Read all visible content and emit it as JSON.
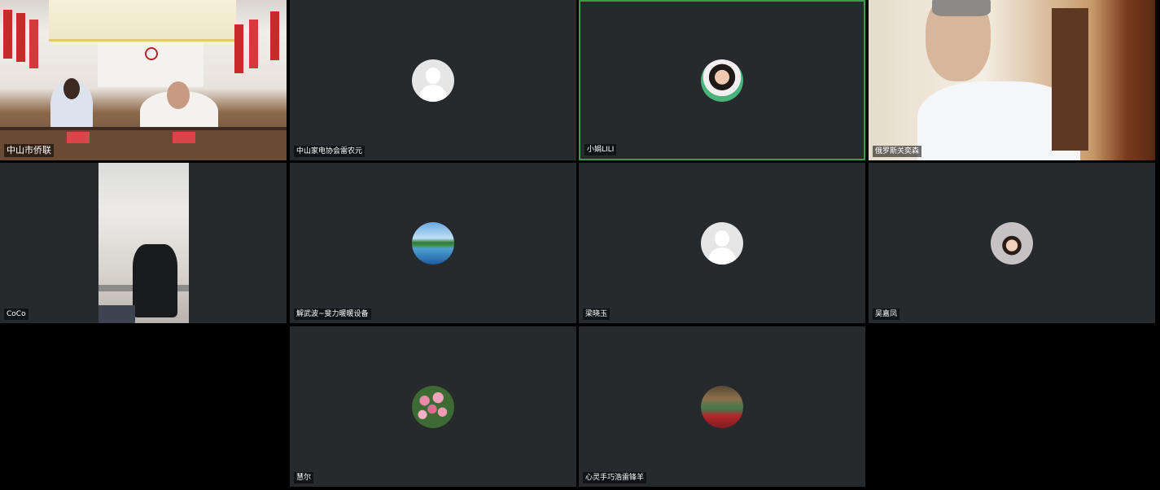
{
  "participants": [
    {
      "name": "中山市侨联",
      "video": true
    },
    {
      "name": "中山家电协会雷农元",
      "video": false,
      "avatar": "default-avatar"
    },
    {
      "name": "小娟LILI",
      "video": false,
      "avatar": "woman-avatar",
      "speaking": true
    },
    {
      "name": "俄罗斯关奕森",
      "video": true
    },
    {
      "name": "CoCo",
      "video": true
    },
    {
      "name": "解武波~斐力暖暖设备",
      "video": false,
      "avatar": "lake-avatar"
    },
    {
      "name": "梁晓玉",
      "video": false,
      "avatar": "default-avatar"
    },
    {
      "name": "吴嘉凤",
      "video": false,
      "avatar": "girl-avatar"
    },
    {
      "name": "慧尔",
      "video": false,
      "avatar": "flowers-avatar"
    },
    {
      "name": "心灵手巧浩雷锋羊",
      "video": false,
      "avatar": "room-avatar"
    }
  ],
  "colors": {
    "background": "#000000",
    "tile": "#262a2d",
    "active_speaker_border": "#3a9a4e"
  }
}
